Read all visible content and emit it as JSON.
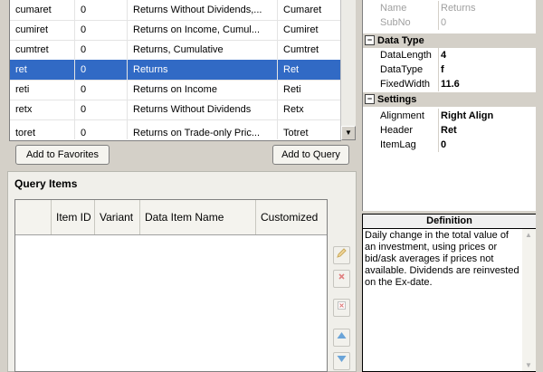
{
  "items": {
    "rows": [
      {
        "code": "cumaret",
        "num": "0",
        "desc": "Returns Without Dividends,...",
        "name": "Cumaret",
        "selected": false
      },
      {
        "code": "cumiret",
        "num": "0",
        "desc": "Returns on Income, Cumul...",
        "name": "Cumiret",
        "selected": false
      },
      {
        "code": "cumtret",
        "num": "0",
        "desc": "Returns, Cumulative",
        "name": "Cumtret",
        "selected": false
      },
      {
        "code": "ret",
        "num": "0",
        "desc": "Returns",
        "name": "Ret",
        "selected": true
      },
      {
        "code": "reti",
        "num": "0",
        "desc": "Returns on Income",
        "name": "Reti",
        "selected": false
      },
      {
        "code": "retx",
        "num": "0",
        "desc": "Returns Without Dividends",
        "name": "Retx",
        "selected": false
      },
      {
        "code": "toret",
        "num": "0",
        "desc": "Returns on Trade-only Pric...",
        "name": "Totret",
        "selected": false
      }
    ],
    "scroll_down_icon": "▼"
  },
  "buttons": {
    "add_favorites": "Add to Favorites",
    "add_query": "Add to Query"
  },
  "query": {
    "title": "Query Items",
    "columns": [
      "Item ID",
      "Variant",
      "Data Item Name",
      "Customized"
    ]
  },
  "props": {
    "top": [
      {
        "key": "Name",
        "value": "Returns"
      },
      {
        "key": "SubNo",
        "value": "0"
      }
    ],
    "data_type_label": "Data Type",
    "data_type": [
      {
        "key": "DataLength",
        "value": "4"
      },
      {
        "key": "DataType",
        "value": "f"
      },
      {
        "key": "FixedWidth",
        "value": "11.6"
      }
    ],
    "settings_label": "Settings",
    "settings": [
      {
        "key": "Alignment",
        "value": "Right Align"
      },
      {
        "key": "Header",
        "value": "Ret"
      },
      {
        "key": "ItemLag",
        "value": "0"
      }
    ],
    "collapse_glyph": "⊟"
  },
  "definition": {
    "header": "Definition",
    "text": "Daily change in the total value of an investment, using prices or bid/ask averages if prices not available.  Dividends are reinvested on the Ex-date."
  },
  "colors": {
    "selection": "#316ac5"
  }
}
